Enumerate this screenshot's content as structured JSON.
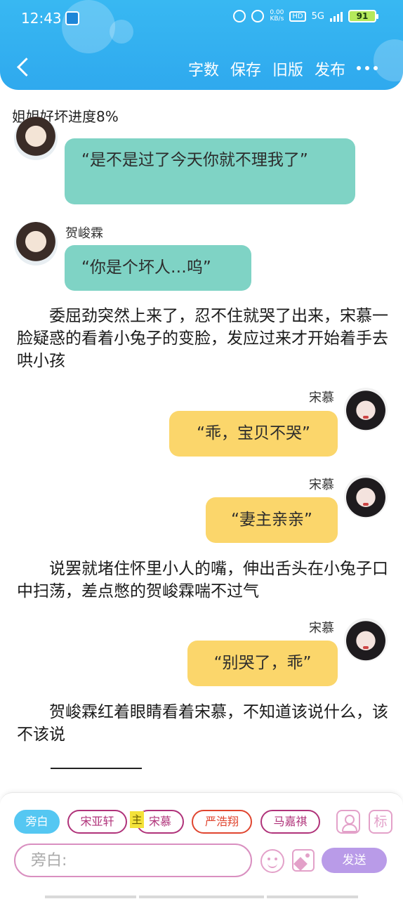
{
  "status_bar": {
    "time": "12:43",
    "net_speed_value": "0.00",
    "net_speed_unit": "KB/s",
    "hd": "HD",
    "signal": "5G",
    "battery": "91"
  },
  "header": {
    "actions": [
      "字数",
      "保存",
      "旧版",
      "发布"
    ],
    "back_icon": "chevron-left-icon",
    "more_icon": "more-dots-icon"
  },
  "progress_text": "姐姐好坏进度8%",
  "chat": {
    "messages": [
      {
        "speaker": "",
        "text": "“是不是过了今天你就不理我了”"
      },
      {
        "speaker": "贺峻霖",
        "text": "“你是个坏人…呜”"
      },
      {
        "speaker": "宋慕",
        "text": "“乖，宝贝不哭”"
      },
      {
        "speaker": "宋慕",
        "text": "“妻主亲亲”"
      },
      {
        "speaker": "宋慕",
        "text": "“别哭了，乖”"
      }
    ],
    "narrations": [
      "委屈劲突然上来了，忍不住就哭了出来，宋慕一脸疑惑的看着小兔子的变脸，发应过来才开始着手去哄小孩",
      "说罢就堵住怀里小人的嘴，伸出舌头在小兔子口中扫荡，差点憋的贺峻霖喘不过气",
      "贺峻霖红着眼睛看着宋慕，不知道该说什么，该不该说"
    ]
  },
  "bottom_bar": {
    "roles": [
      "旁白",
      "宋亚轩",
      "宋慕",
      "严浩翔",
      "马嘉祺"
    ],
    "host_badge": "主",
    "tag_icon_label": "标",
    "input_placeholder": "旁白:",
    "send_label": "发送"
  },
  "colors": {
    "header_blue": "#38b8f2",
    "left_bubble": "#7fd3c5",
    "right_bubble": "#fbd66b",
    "send_button": "#b99be8",
    "active_chip": "#55c7f2"
  }
}
